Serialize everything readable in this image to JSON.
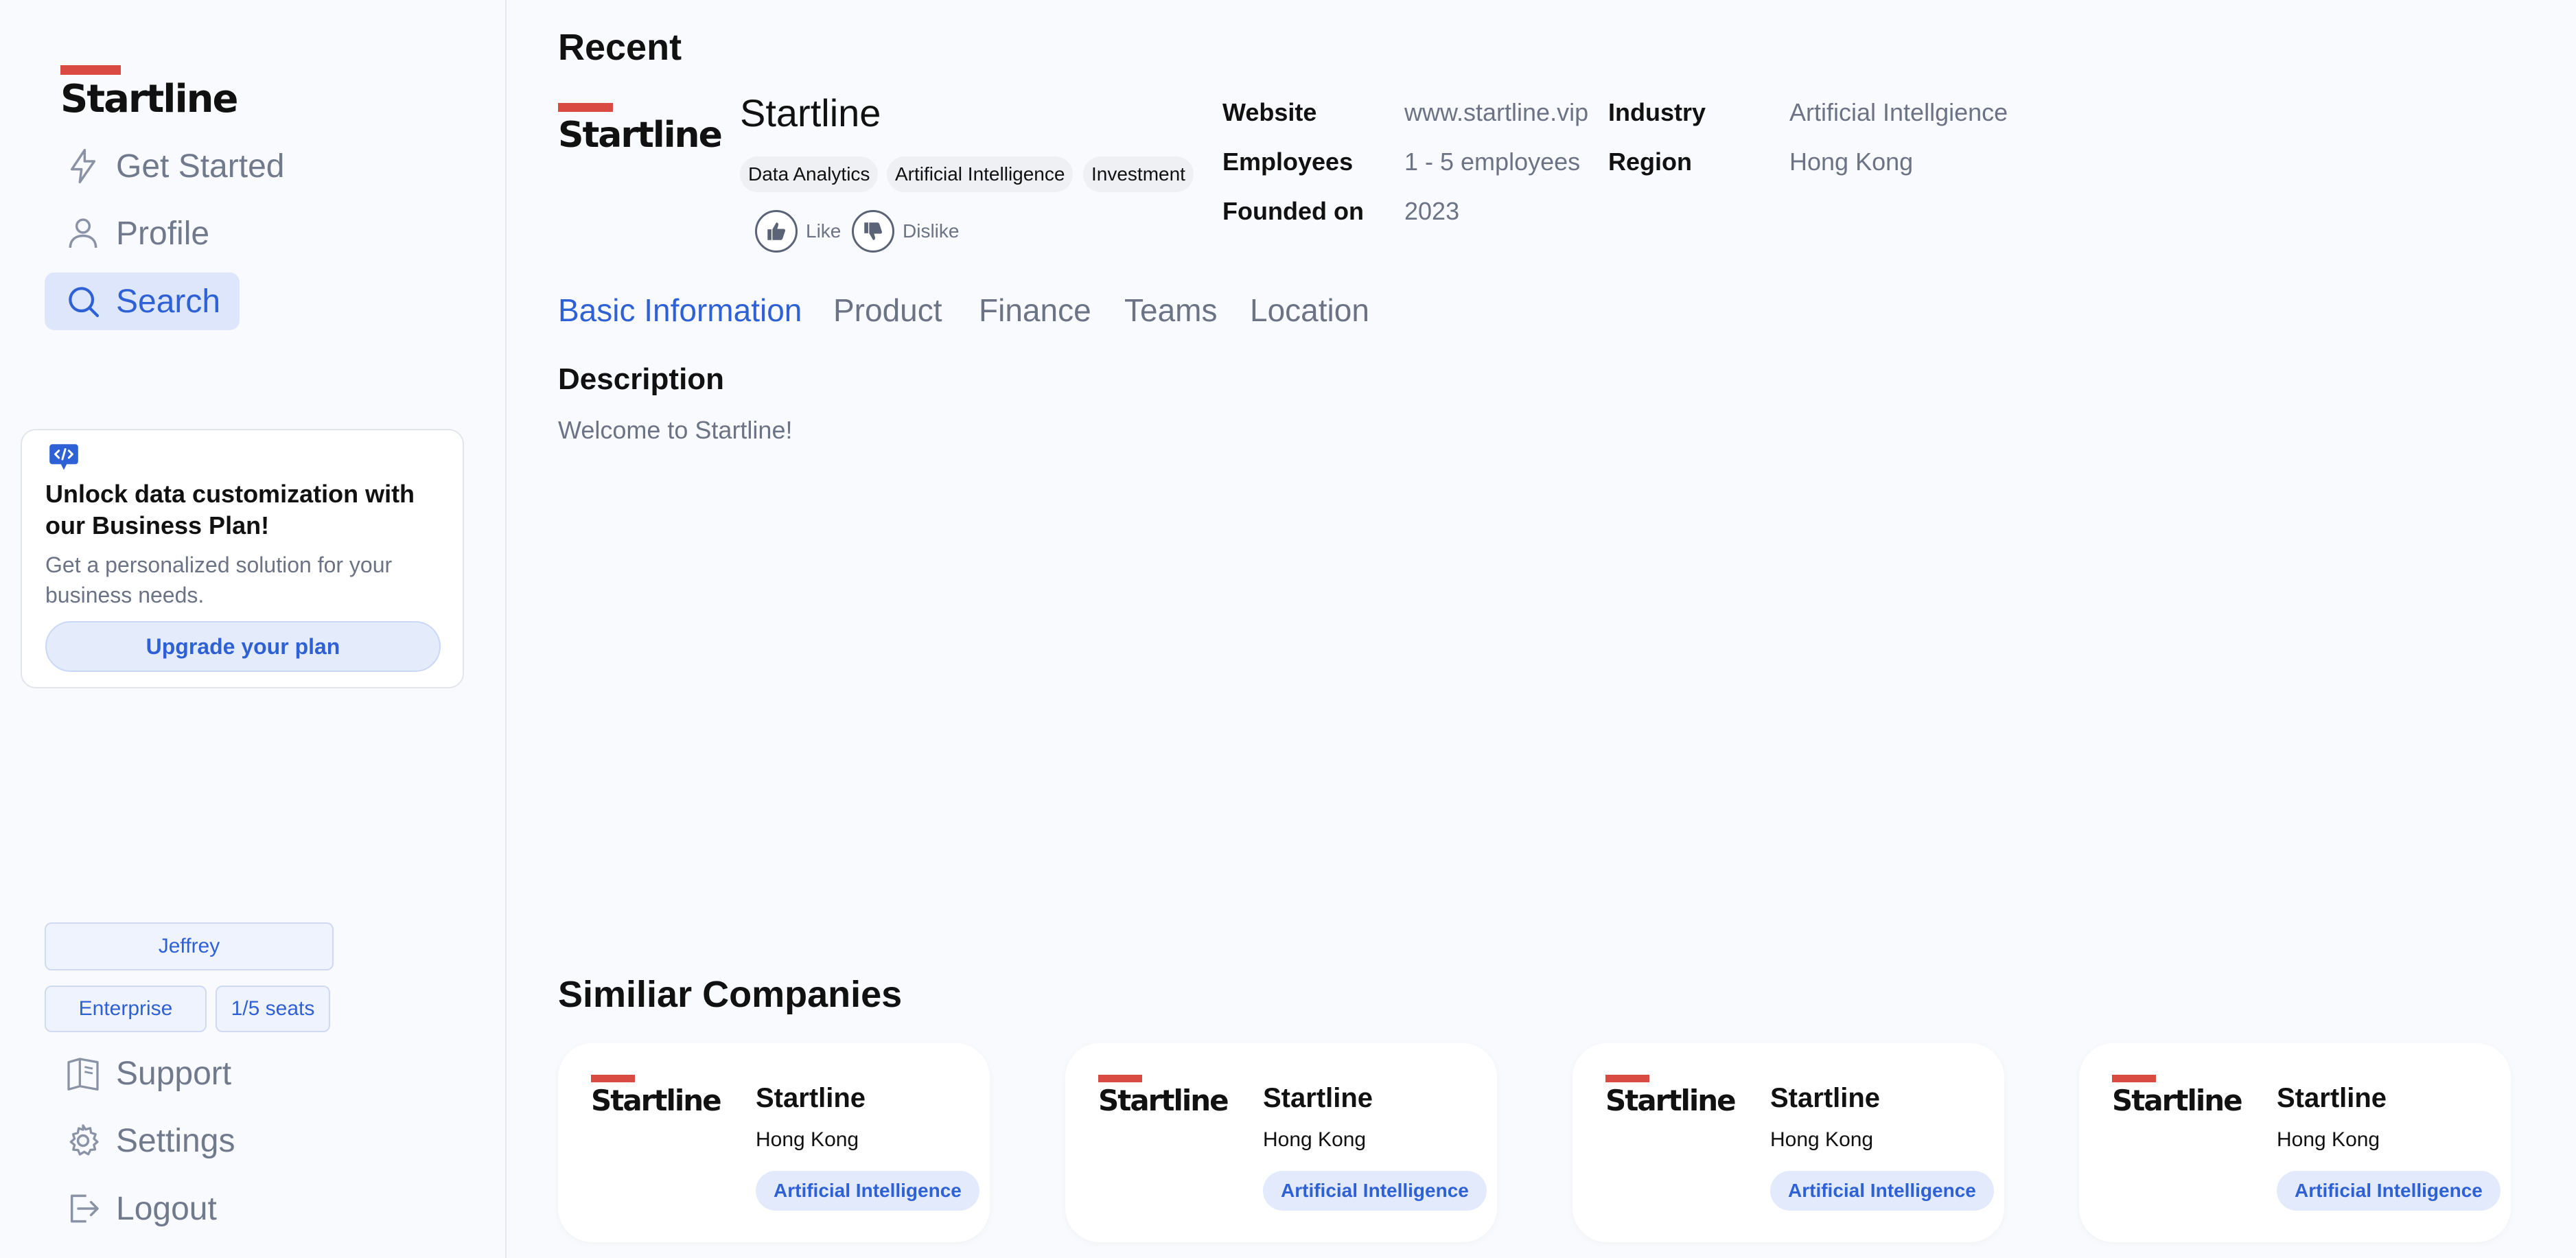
{
  "brand": {
    "wordmark": "Startline",
    "accent": "#d94a43",
    "primary": "#2f61d6"
  },
  "sidebar": {
    "nav": [
      {
        "label": "Get Started",
        "icon": "lightning-icon"
      },
      {
        "label": "Profile",
        "icon": "user-icon"
      },
      {
        "label": "Search",
        "icon": "search-icon",
        "active": true
      }
    ],
    "promo": {
      "icon": "code-chat-icon",
      "title": "Unlock data customization with our Business Plan!",
      "description": "Get a personalized solution for your business needs.",
      "button": "Upgrade your plan"
    },
    "user": {
      "name": "Jeffrey",
      "plan": "Enterprise",
      "seats": "1/5 seats"
    },
    "bottom_nav": [
      {
        "label": "Support",
        "icon": "book-icon"
      },
      {
        "label": "Settings",
        "icon": "gear-icon"
      },
      {
        "label": "Logout",
        "icon": "logout-icon"
      }
    ]
  },
  "recent": {
    "heading": "Recent",
    "company": {
      "name": "Startline",
      "tags": [
        "Data Analytics",
        "Artificial Intelligence",
        "Investment"
      ],
      "like_label": "Like",
      "dislike_label": "Dislike"
    },
    "info": {
      "website_label": "Website",
      "website": "www.startline.vip",
      "employees_label": "Employees",
      "employees": "1 - 5 employees",
      "founded_label": "Founded on",
      "founded": "2023",
      "industry_label": "Industry",
      "industry": "Artificial Intellgience",
      "region_label": "Region",
      "region": "Hong Kong"
    },
    "tabs": [
      "Basic Information",
      "Product",
      "Finance",
      "Teams",
      "Location"
    ],
    "active_tab": "Basic Information",
    "description": {
      "title": "Description",
      "text": "Welcome to Startline!"
    }
  },
  "similar": {
    "heading": "Similiar Companies",
    "cards": [
      {
        "name": "Startline",
        "region": "Hong Kong",
        "tag": "Artificial Intelligence"
      },
      {
        "name": "Startline",
        "region": "Hong Kong",
        "tag": "Artificial Intelligence"
      },
      {
        "name": "Startline",
        "region": "Hong Kong",
        "tag": "Artificial Intelligence"
      },
      {
        "name": "Startline",
        "region": "Hong Kong",
        "tag": "Artificial Intelligence"
      }
    ]
  }
}
